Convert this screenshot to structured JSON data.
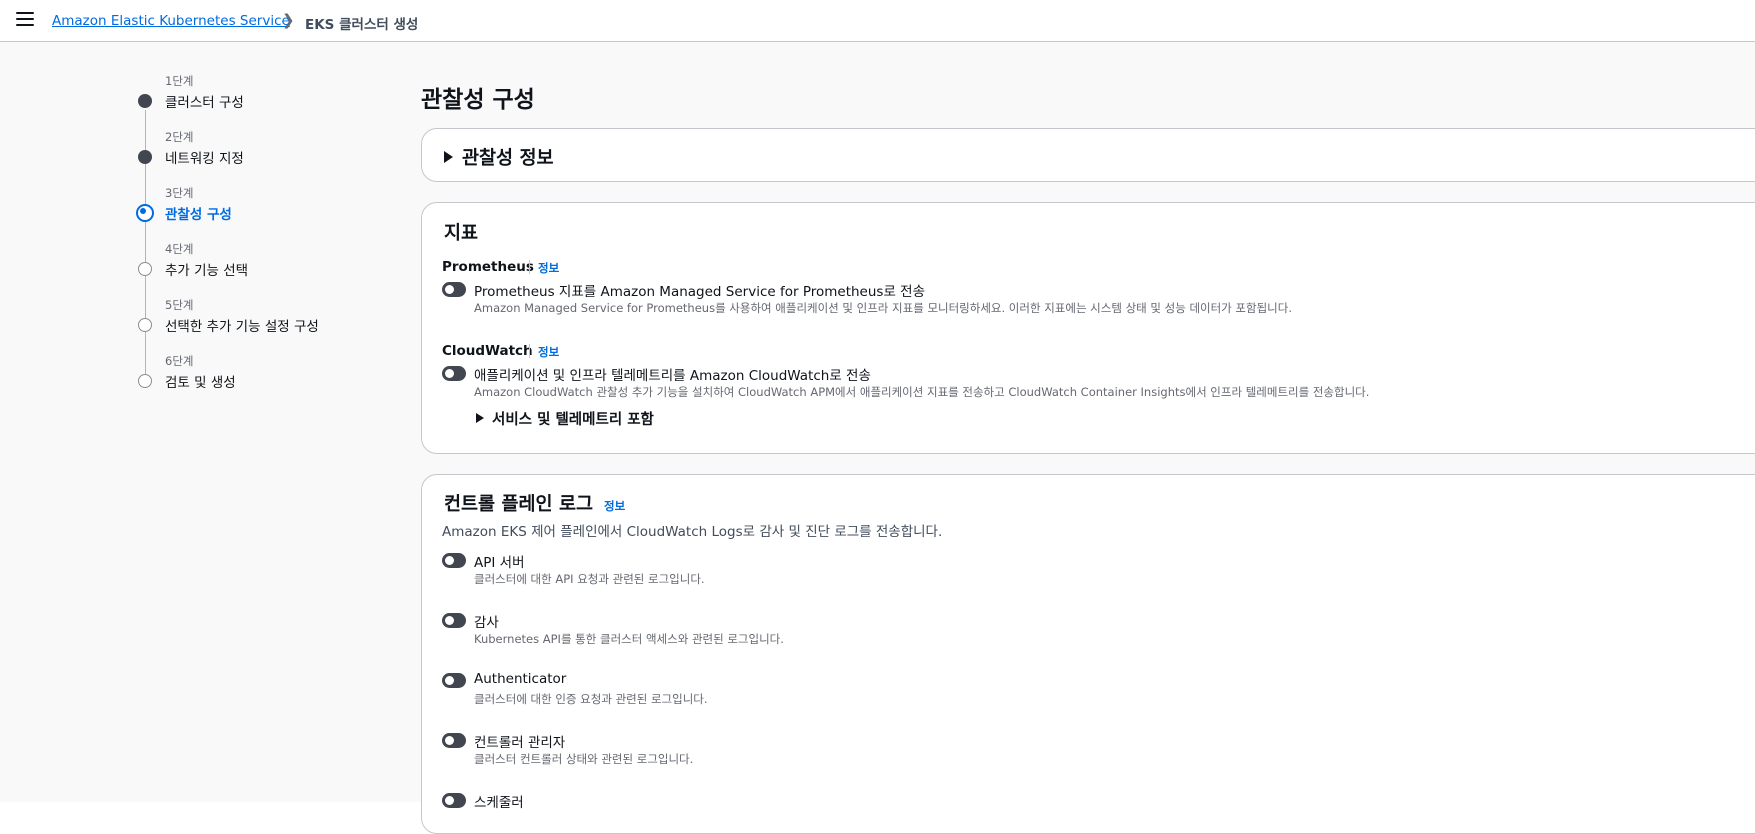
{
  "breadcrumb": {
    "service": "Amazon Elastic Kubernetes Service",
    "current": "EKS 클러스터 생성"
  },
  "steps": [
    {
      "num": "1단계",
      "label": "클러스터 구성",
      "state": "done"
    },
    {
      "num": "2단계",
      "label": "네트워킹 지정",
      "state": "done"
    },
    {
      "num": "3단계",
      "label": "관찰성 구성",
      "state": "current"
    },
    {
      "num": "4단계",
      "label": "추가 기능 선택",
      "state": "todo"
    },
    {
      "num": "5단계",
      "label": "선택한 추가 기능 설정 구성",
      "state": "todo"
    },
    {
      "num": "6단계",
      "label": "검토 및 생성",
      "state": "todo"
    }
  ],
  "page_title": "관찰성 구성",
  "info_panel": {
    "title": "관찰성 정보"
  },
  "metrics": {
    "title": "지표",
    "prometheus": {
      "label": "Prometheus",
      "info": "정보",
      "toggle_label": "Prometheus 지표를 Amazon Managed Service for Prometheus로 전송",
      "toggle_desc": "Amazon Managed Service for Prometheus를 사용하여 애플리케이션 및 인프라 지표를 모니터링하세요. 이러한 지표에는 시스템 상태 및 성능 데이터가 포함됩니다.",
      "enabled": false
    },
    "cloudwatch": {
      "label": "CloudWatch",
      "info": "정보",
      "toggle_label": "애플리케이션 및 인프라 텔레메트리를 Amazon CloudWatch로 전송",
      "toggle_desc": "Amazon CloudWatch 관찰성 추가 기능을 설치하여 CloudWatch APM에서 애플리케이션 지표를 전송하고 CloudWatch Container Insights에서 인프라 텔레메트리를 전송합니다.",
      "enabled": false,
      "expander": "서비스 및 텔레메트리 포함"
    }
  },
  "control_plane": {
    "title": "컨트롤 플레인 로그",
    "info": "정보",
    "desc": "Amazon EKS 제어 플레인에서 CloudWatch Logs로 감사 및 진단 로그를 전송합니다.",
    "logs": [
      {
        "label": "API 서버",
        "desc": "클러스터에 대한 API 요청과 관련된 로그입니다.",
        "enabled": false
      },
      {
        "label": "감사",
        "desc": "Kubernetes API를 통한 클러스터 액세스와 관련된 로그입니다.",
        "enabled": false
      },
      {
        "label": "Authenticator",
        "desc": "클러스터에 대한 인증 요청과 관련된 로그입니다.",
        "enabled": false
      },
      {
        "label": "컨트롤러 관리자",
        "desc": "클러스터 컨트롤러 상태와 관련된 로그입니다.",
        "enabled": false
      },
      {
        "label": "스케줄러",
        "desc": "",
        "enabled": false
      }
    ]
  },
  "colors": {
    "accent": "#006ce0",
    "toggle_off": "#424650"
  }
}
